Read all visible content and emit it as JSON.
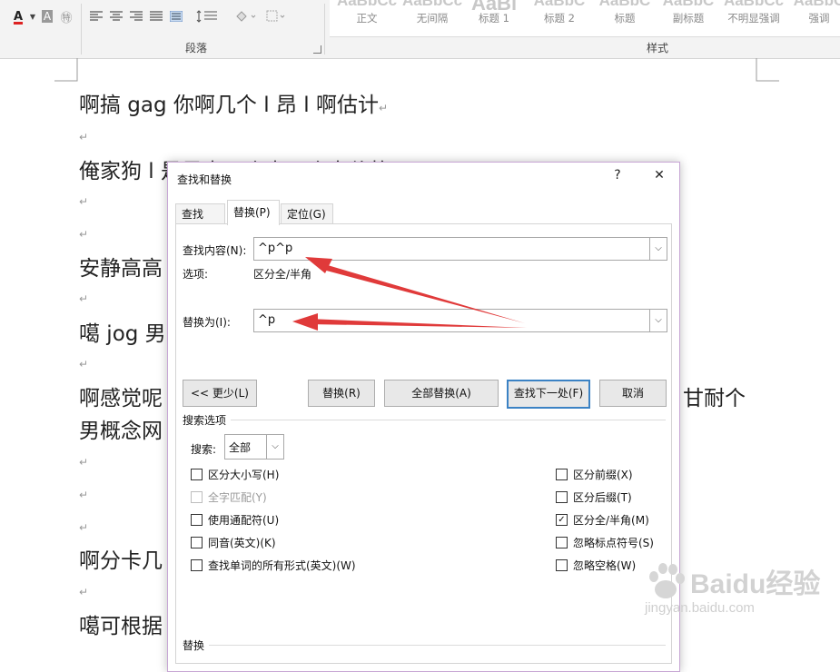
{
  "ribbon": {
    "font_color": "A",
    "clear_format": "A",
    "char_style": "㊕",
    "paragraph_group_label": "段落",
    "styles_group_label": "样式",
    "styles": [
      {
        "preview": "AaBbCc",
        "label": "正文"
      },
      {
        "preview": "AaBbCc",
        "label": "无间隔"
      },
      {
        "preview": "AaBl",
        "label": "标题 1"
      },
      {
        "preview": "AaBbC",
        "label": "标题 2"
      },
      {
        "preview": "AaBbC",
        "label": "标题"
      },
      {
        "preview": "AaBbC",
        "label": "副标题"
      },
      {
        "preview": "AaBbCc",
        "label": "不明显强调"
      },
      {
        "preview": "AaBbC",
        "label": "强调"
      }
    ]
  },
  "document": {
    "lines": [
      "啊搞 gag 你啊几个 l 昂 l 啊估计",
      "俺家狗 l 是是卡几个卡几个卡价格",
      "安静高高",
      "噶 jog 男",
      "啊感觉呢",
      "甘耐个",
      "男概念网",
      "啊分卡几",
      "噶可根据"
    ],
    "paragraph_mark": "↵"
  },
  "dialog": {
    "title": "查找和替换",
    "help_button": "?",
    "close_button": "✕",
    "tabs": [
      "查找(D)",
      "替换(P)",
      "定位(G)"
    ],
    "find_label": "查找内容(N):",
    "find_value": "^p^p",
    "options_label": "选项:",
    "options_value": "区分全/半角",
    "replace_label": "替换为(I):",
    "replace_value": "^p",
    "buttons": {
      "less": "<< 更少(L)",
      "replace": "替换(R)",
      "replace_all": "全部替换(A)",
      "find_next": "查找下一处(F)",
      "cancel": "取消"
    },
    "search_options_title": "搜索选项",
    "search_label": "搜索:",
    "search_value": "全部",
    "left_options": [
      {
        "label": "区分大小写(H)",
        "checked": false,
        "disabled": false
      },
      {
        "label": "全字匹配(Y)",
        "checked": false,
        "disabled": true
      },
      {
        "label": "使用通配符(U)",
        "checked": false,
        "disabled": false
      },
      {
        "label": "同音(英文)(K)",
        "checked": false,
        "disabled": false
      },
      {
        "label": "查找单词的所有形式(英文)(W)",
        "checked": false,
        "disabled": false
      }
    ],
    "right_options": [
      {
        "label": "区分前缀(X)",
        "checked": false
      },
      {
        "label": "区分后缀(T)",
        "checked": false
      },
      {
        "label": "区分全/半角(M)",
        "checked": true
      },
      {
        "label": "忽略标点符号(S)",
        "checked": false
      },
      {
        "label": "忽略空格(W)",
        "checked": false
      }
    ],
    "replace_section_title": "替换",
    "check_mark": "✓"
  },
  "watermark": {
    "text": "Baidu经验",
    "sub": "jingyan.baidu.com"
  },
  "colors": {
    "arrow": "#e03a3a",
    "focus": "#3b82c4",
    "dialog_border": "#c7a6d4",
    "font_color_red": "#d22"
  }
}
